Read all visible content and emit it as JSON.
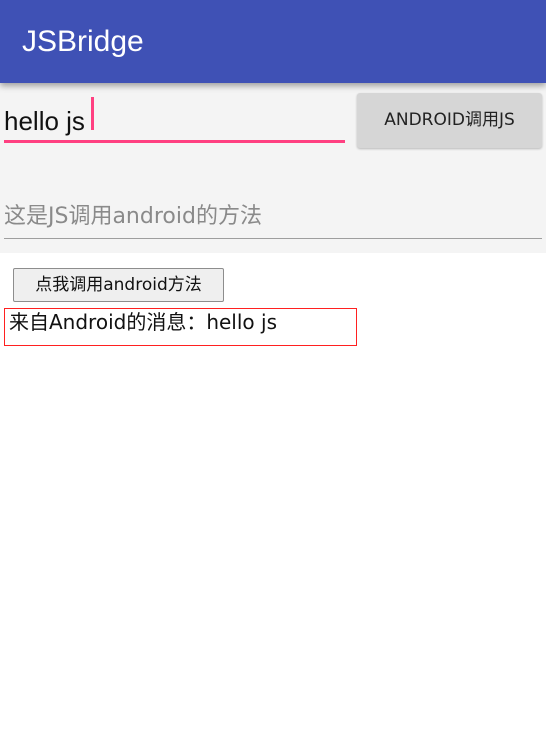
{
  "app_bar": {
    "title": "JSBridge"
  },
  "native": {
    "input_value": "hello js",
    "call_js_button": "ANDROID调用JS",
    "display_text": "这是JS调用android的方法"
  },
  "web": {
    "call_android_button": "点我调用android方法",
    "message": "来自Android的消息：hello js"
  },
  "colors": {
    "primary": "#3f51b5",
    "accent": "#ff4081",
    "message_border": "#ff2020"
  }
}
